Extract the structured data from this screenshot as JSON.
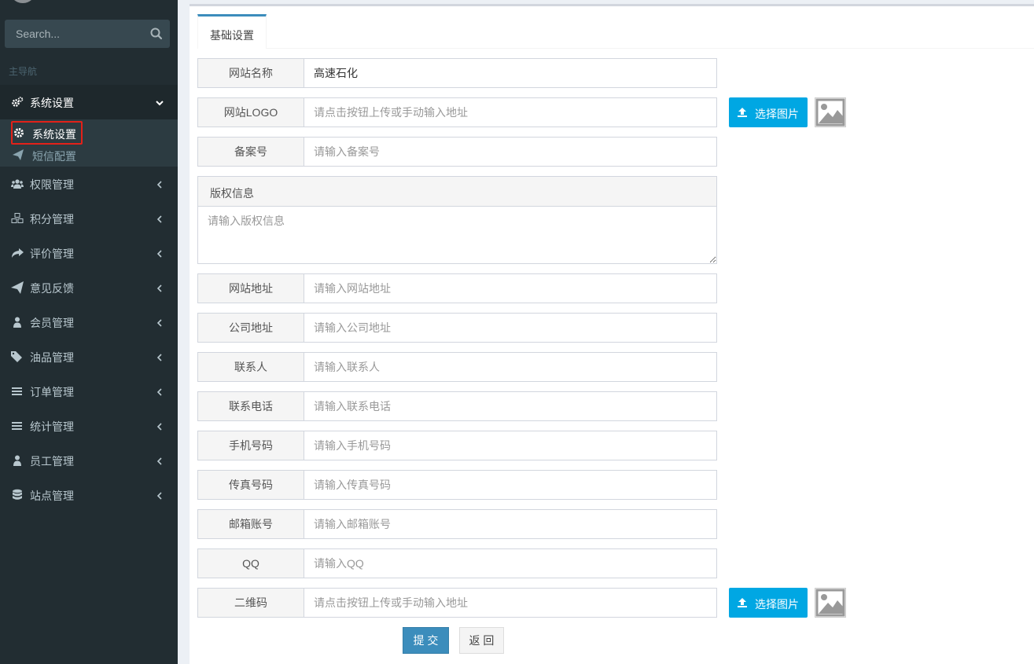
{
  "sidebar": {
    "search_placeholder": "Search...",
    "nav_header": "主导航",
    "menu": [
      {
        "label": "系统设置",
        "icon": "gears-icon"
      },
      {
        "label": "权限管理",
        "icon": "users-icon"
      },
      {
        "label": "积分管理",
        "icon": "cubes-icon"
      },
      {
        "label": "评价管理",
        "icon": "share-icon"
      },
      {
        "label": "意见反馈",
        "icon": "paper-plane-icon"
      },
      {
        "label": "会员管理",
        "icon": "user-icon"
      },
      {
        "label": "油品管理",
        "icon": "tags-icon"
      },
      {
        "label": "订单管理",
        "icon": "bars-icon"
      },
      {
        "label": "统计管理",
        "icon": "bars-icon"
      },
      {
        "label": "员工管理",
        "icon": "user-icon"
      },
      {
        "label": "站点管理",
        "icon": "database-icon"
      }
    ],
    "submenu": [
      {
        "label": "系统设置",
        "icon": "gear-icon"
      },
      {
        "label": "短信配置",
        "icon": "paper-plane-icon"
      }
    ]
  },
  "tabs": {
    "active": "基础设置"
  },
  "form": {
    "site_name": {
      "label": "网站名称",
      "value": "高速石化"
    },
    "site_logo": {
      "label": "网站LOGO",
      "placeholder": "请点击按钮上传或手动输入地址"
    },
    "icp": {
      "label": "备案号",
      "placeholder": "请输入备案号"
    },
    "copyright": {
      "label": "版权信息",
      "placeholder": "请输入版权信息"
    },
    "site_url": {
      "label": "网站地址",
      "placeholder": "请输入网站地址"
    },
    "company_address": {
      "label": "公司地址",
      "placeholder": "请输入公司地址"
    },
    "contact": {
      "label": "联系人",
      "placeholder": "请输入联系人"
    },
    "phone": {
      "label": "联系电话",
      "placeholder": "请输入联系电话"
    },
    "mobile": {
      "label": "手机号码",
      "placeholder": "请输入手机号码"
    },
    "fax": {
      "label": "传真号码",
      "placeholder": "请输入传真号码"
    },
    "email": {
      "label": "邮箱账号",
      "placeholder": "请输入邮箱账号"
    },
    "qq": {
      "label": "QQ",
      "placeholder": "请输入QQ"
    },
    "qrcode": {
      "label": "二维码",
      "placeholder": "请点击按钮上传或手动输入地址"
    },
    "upload_label": "选择图片",
    "submit_label": "提 交",
    "back_label": "返 回"
  },
  "colors": {
    "sidebar_bg": "#222d32",
    "primary": "#3c8dbc",
    "upload": "#00a7e3",
    "highlight_border": "#e32119"
  }
}
